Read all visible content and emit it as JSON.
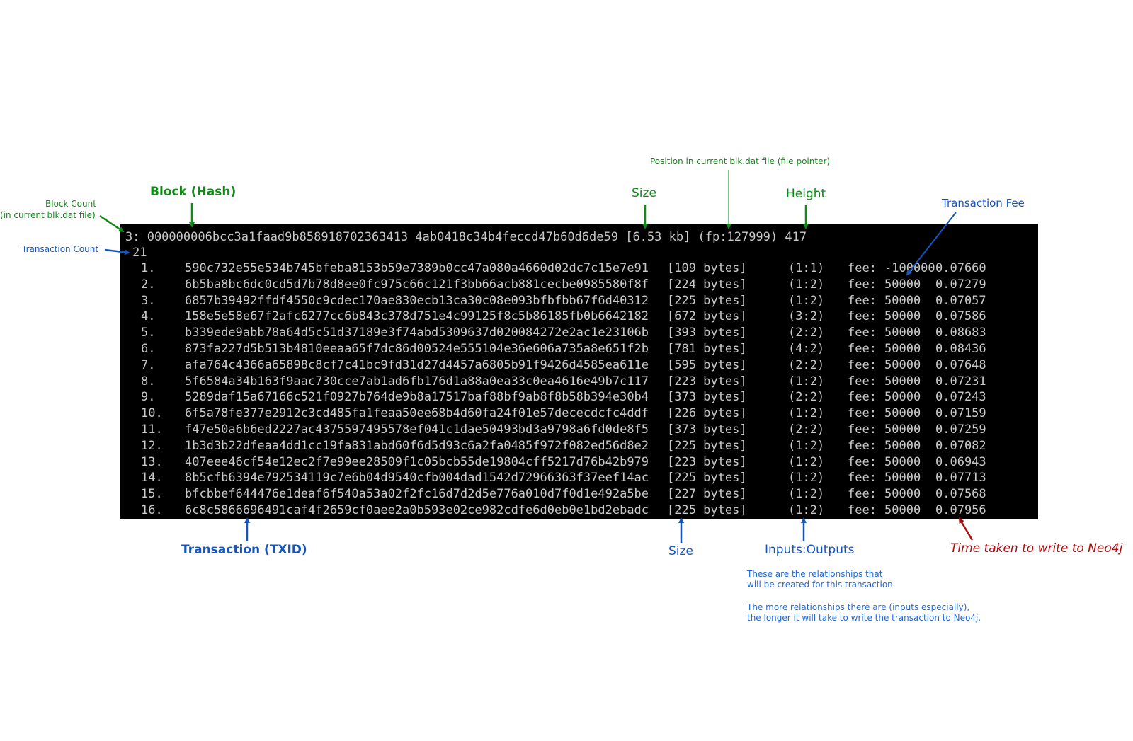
{
  "terminal": {
    "header_line": "3: 000000006bcc3a1faad9b858918702363413 4ab0418c34b4feccd47b60d6de59 [6.53 kb] (fp:127999) 417",
    "tx_count": "21",
    "rows": [
      {
        "num": "1.",
        "txid": "590c732e55e534b745bfeba8153b59e7389b0cc47a080a4660d02dc7c15e7e91",
        "size": "[109 bytes]",
        "io": "(1:1)",
        "fee_label": "fee:",
        "fee": "-100000",
        "time": "0.07660"
      },
      {
        "num": "2.",
        "txid": "6b5ba8bc6dc0cd5d7b78d8ee0fc975c66c121f3bb66acb881cecbe0985580f8f",
        "size": "[224 bytes]",
        "io": "(1:2)",
        "fee_label": "fee:",
        "fee": "50000",
        "time": "0.07279"
      },
      {
        "num": "3.",
        "txid": "6857b39492ffdf4550c9cdec170ae830ecb13ca30c08e093bfbfbb67f6d40312",
        "size": "[225 bytes]",
        "io": "(1:2)",
        "fee_label": "fee:",
        "fee": "50000",
        "time": "0.07057"
      },
      {
        "num": "4.",
        "txid": "158e5e58e67f2afc6277cc6b843c378d751e4c99125f8c5b86185fb0b6642182",
        "size": "[672 bytes]",
        "io": "(3:2)",
        "fee_label": "fee:",
        "fee": "50000",
        "time": "0.07586"
      },
      {
        "num": "5.",
        "txid": "b339ede9abb78a64d5c51d37189e3f74abd5309637d020084272e2ac1e23106b",
        "size": "[393 bytes]",
        "io": "(2:2)",
        "fee_label": "fee:",
        "fee": "50000",
        "time": "0.08683"
      },
      {
        "num": "6.",
        "txid": "873fa227d5b513b4810eeaa65f7dc86d00524e555104e36e606a735a8e651f2b",
        "size": "[781 bytes]",
        "io": "(4:2)",
        "fee_label": "fee:",
        "fee": "50000",
        "time": "0.08436"
      },
      {
        "num": "7.",
        "txid": "afa764c4366a65898c8cf7c41bc9fd31d27d4457a6805b91f9426d4585ea611e",
        "size": "[595 bytes]",
        "io": "(2:2)",
        "fee_label": "fee:",
        "fee": "50000",
        "time": "0.07648"
      },
      {
        "num": "8.",
        "txid": "5f6584a34b163f9aac730cce7ab1ad6fb176d1a88a0ea33c0ea4616e49b7c117",
        "size": "[223 bytes]",
        "io": "(1:2)",
        "fee_label": "fee:",
        "fee": "50000",
        "time": "0.07231"
      },
      {
        "num": "9.",
        "txid": "5289daf15a67166c521f0927b764de9b8a17517baf88bf9ab8f8b58b394e30b4",
        "size": "[373 bytes]",
        "io": "(2:2)",
        "fee_label": "fee:",
        "fee": "50000",
        "time": "0.07243"
      },
      {
        "num": "10.",
        "txid": "6f5a78fe377e2912c3cd485fa1feaa50ee68b4d60fa24f01e57dececdcfc4ddf",
        "size": "[226 bytes]",
        "io": "(1:2)",
        "fee_label": "fee:",
        "fee": "50000",
        "time": "0.07159"
      },
      {
        "num": "11.",
        "txid": "f47e50a6b6ed2227ac4375597495578ef041c1dae50493bd3a9798a6fd0de8f5",
        "size": "[373 bytes]",
        "io": "(2:2)",
        "fee_label": "fee:",
        "fee": "50000",
        "time": "0.07259"
      },
      {
        "num": "12.",
        "txid": "1b3d3b22dfeaa4dd1cc19fa831abd60f6d5d93c6a2fa0485f972f082ed56d8e2",
        "size": "[225 bytes]",
        "io": "(1:2)",
        "fee_label": "fee:",
        "fee": "50000",
        "time": "0.07082"
      },
      {
        "num": "13.",
        "txid": "407eee46cf54e12ec2f7e99ee28509f1c05bcb55de19804cff5217d76b42b979",
        "size": "[223 bytes]",
        "io": "(1:2)",
        "fee_label": "fee:",
        "fee": "50000",
        "time": "0.06943"
      },
      {
        "num": "14.",
        "txid": "8b5cfb6394e792534119c7e6b04d9540cfb004dad1542d72966363f37eef14ac",
        "size": "[225 bytes]",
        "io": "(1:2)",
        "fee_label": "fee:",
        "fee": "50000",
        "time": "0.07713"
      },
      {
        "num": "15.",
        "txid": "bfcbbef644476e1deaf6f540a53a02f2fc16d7d2d5e776a010d7f0d1e492a5be",
        "size": "[227 bytes]",
        "io": "(1:2)",
        "fee_label": "fee:",
        "fee": "50000",
        "time": "0.07568"
      },
      {
        "num": "16.",
        "txid": "6c8c5866696491caf4f2659cf0aee2a0b593e02ce982cdfe6d0eb0e1bd2ebadc",
        "size": "[225 bytes]",
        "io": "(1:2)",
        "fee_label": "fee:",
        "fee": "50000",
        "time": "0.07956"
      }
    ]
  },
  "annotations": {
    "block_count_line1": "Block Count",
    "block_count_line2": "(in current blk.dat file)",
    "block_hash": "Block (Hash)",
    "size_top": "Size",
    "file_pointer": "Position in current blk.dat file (file pointer)",
    "height": "Height",
    "transaction_fee": "Transaction Fee",
    "transaction_count": "Transaction Count",
    "txid": "Transaction (TXID)",
    "size_bottom": "Size",
    "inputs_outputs": "Inputs:Outputs",
    "io_note_line1": "These are the relationships that",
    "io_note_line2": "will be created for this transaction.",
    "io_note_line3": "The more relationships there are (inputs especially),",
    "io_note_line4": "the longer it will take to write the transaction to Neo4j.",
    "time_taken": "Time taken to write to Neo4j"
  },
  "colors": {
    "green": "#0f8a17",
    "blue": "#1455c0",
    "light_blue": "#2169d6",
    "red": "#b00e0e",
    "terminal_bg": "#000000",
    "terminal_text": "#c9c9c9"
  }
}
